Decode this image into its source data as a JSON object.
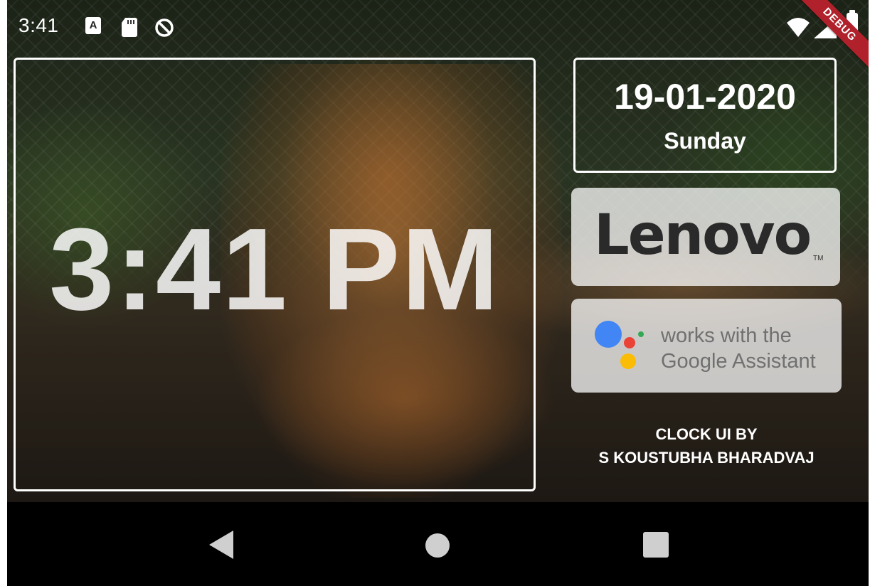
{
  "status_bar": {
    "time": "3:41",
    "notification_icons": [
      "a-badge-icon",
      "sd-card-icon",
      "sync-icon"
    ],
    "system_icons": [
      "wifi-icon",
      "signal-icon",
      "battery-icon"
    ],
    "notif_a_letter": "A"
  },
  "debug_banner": {
    "label": "DEBUG",
    "color": "#b0212b"
  },
  "clock": {
    "time": "3:41 PM"
  },
  "date_panel": {
    "date": "19-01-2020",
    "day": "Sunday"
  },
  "lenovo_card": {
    "logo_text": "Lenovo",
    "tm": "TM"
  },
  "assistant_card": {
    "line1": "works with the",
    "line2": "Google Assistant",
    "dot_colors": [
      "#4285F4",
      "#EA4335",
      "#FBBC05",
      "#34A853"
    ]
  },
  "credit": {
    "line1": "CLOCK UI BY",
    "line2": "S KOUSTUBHA BHARADVAJ"
  },
  "nav_bar": {
    "buttons": [
      "back-icon",
      "home-icon",
      "recents-icon"
    ]
  },
  "background": {
    "subject": "tiger-photo"
  }
}
